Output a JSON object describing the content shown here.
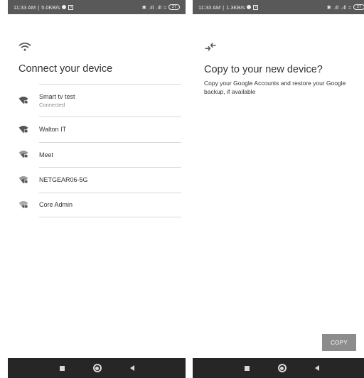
{
  "left_screen": {
    "statusbar": {
      "time": "11:33 AM",
      "speed": "5.0KB/s",
      "battery": "27"
    },
    "title": "Connect your device",
    "networks": [
      {
        "name": "Smart tv test",
        "status": "Connected"
      },
      {
        "name": "Walton IT",
        "status": ""
      },
      {
        "name": "Meet",
        "status": ""
      },
      {
        "name": "NETGEAR06-5G",
        "status": ""
      },
      {
        "name": "Core Admin",
        "status": ""
      }
    ],
    "icons": {
      "header": "wifi-icon",
      "network": "wifi-lock-icon"
    }
  },
  "right_screen": {
    "statusbar": {
      "time": "11:33 AM",
      "speed": "1.3KB/s",
      "battery": "27"
    },
    "title": "Copy to your new device?",
    "description": "Copy your Google Accounts and restore your Google backup, if available",
    "copy_button": "COPY",
    "icons": {
      "header": "transfer-arrows-icon"
    }
  },
  "colors": {
    "statusbar": "#595959",
    "navbar": "#262626",
    "button": "#8c8c8c",
    "divider": "#d9d9d9"
  }
}
